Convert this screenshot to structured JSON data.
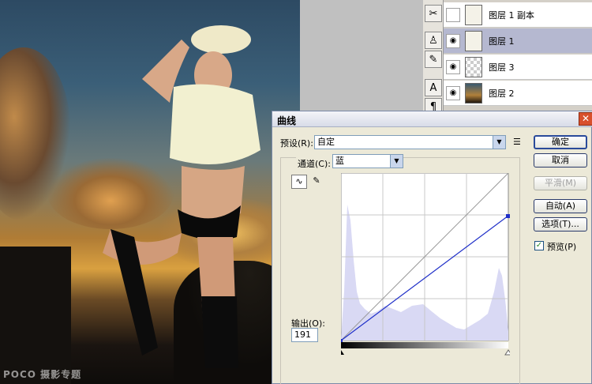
{
  "photo": {
    "watermark": "POCO 摄影专题"
  },
  "tools": {
    "icons": [
      "scissors-icon",
      "stamp-icon",
      "brush-icon",
      "type-icon",
      "paragraph-icon"
    ]
  },
  "layers": [
    {
      "name": "图层 1 副本",
      "visible": false,
      "thumb": "figure",
      "selected": false
    },
    {
      "name": "图层 1",
      "visible": true,
      "thumb": "figure",
      "selected": true
    },
    {
      "name": "图层 3",
      "visible": true,
      "thumb": "checker",
      "selected": false
    },
    {
      "name": "图层 2",
      "visible": true,
      "thumb": "photo",
      "selected": false
    }
  ],
  "dialog": {
    "title": "曲线",
    "close": "✕",
    "preset_label": "预设(R):",
    "preset_value": "自定",
    "channel_label": "通道(C):",
    "channel_value": "蓝",
    "output_label": "输出(O):",
    "output_value": "191",
    "buttons": {
      "ok": "确定",
      "cancel": "取消",
      "smooth": "平滑(M)",
      "auto": "自动(A)",
      "options": "选项(T)..."
    },
    "preview_label": "预览(P)",
    "preview_checked": true,
    "curve_color": "#1f2fc8",
    "histogram_color": "#d9d9f4"
  }
}
